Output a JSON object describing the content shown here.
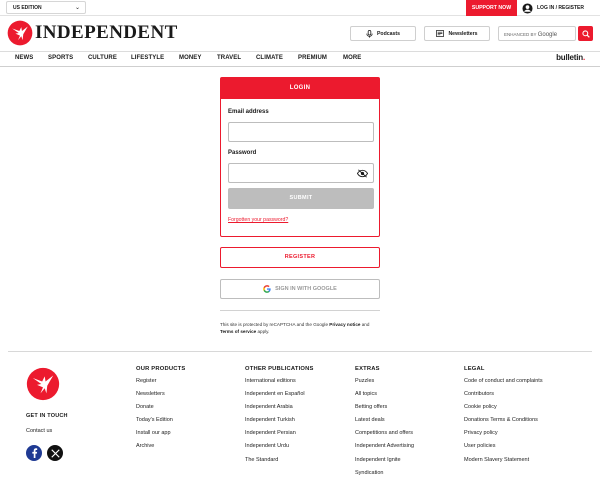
{
  "topbar": {
    "edition": "US EDITION",
    "support": "SUPPORT NOW",
    "login_register": "LOG IN / REGISTER"
  },
  "header": {
    "logo_text": "INDEPENDENT",
    "podcasts": "Podcasts",
    "newsletters": "Newsletters",
    "search_enhanced": "ENHANCED BY",
    "search_google": "Google"
  },
  "nav": {
    "items": [
      "NEWS",
      "SPORTS",
      "CULTURE",
      "LIFESTYLE",
      "MONEY",
      "TRAVEL",
      "CLIMATE",
      "PREMIUM",
      "MORE"
    ],
    "bulletin": "bulletin",
    "bulletin_dot": "."
  },
  "login": {
    "title": "LOGIN",
    "email_label": "Email address",
    "email_value": "",
    "password_label": "Password",
    "password_value": "",
    "submit": "SUBMIT",
    "forgot": "Forgotten your password?"
  },
  "register": "REGISTER",
  "google_signin": "SIGN IN WITH GOOGLE",
  "recaptcha": {
    "text1": "This site is protected by reCAPTCHA and the Google ",
    "privacy": "Privacy notice",
    "text2": " and ",
    "terms": "Terms of service",
    "text3": " apply."
  },
  "footer": {
    "get_in_touch": "GET IN TOUCH",
    "contact": "Contact us",
    "columns": [
      {
        "title": "OUR PRODUCTS",
        "links": [
          "Register",
          "Newsletters",
          "Donate",
          "Today's Edition",
          "Install our app",
          "Archive"
        ]
      },
      {
        "title": "OTHER PUBLICATIONS",
        "links": [
          "International editions",
          "Independent en Español",
          "Independent Arabia",
          "Independent Turkish",
          "Independent Persian",
          "Independent Urdu",
          "The Standard"
        ]
      },
      {
        "title": "EXTRAS",
        "links": [
          "Puzzles",
          "All topics",
          "Betting offers",
          "Latest deals",
          "Competitions and offers",
          "Independent Advertising",
          "Independent Ignite",
          "Syndication"
        ]
      },
      {
        "title": "LEGAL",
        "links": [
          "Code of conduct and complaints",
          "Contributors",
          "Cookie policy",
          "Donations Terms & Conditions",
          "Privacy policy",
          "User policies",
          "Modern Slavery Statement"
        ]
      }
    ]
  },
  "colors": {
    "brand_red": "#ec1a2e",
    "disabled_gray": "#bdbdbd",
    "facebook_blue": "#1f3a93"
  }
}
